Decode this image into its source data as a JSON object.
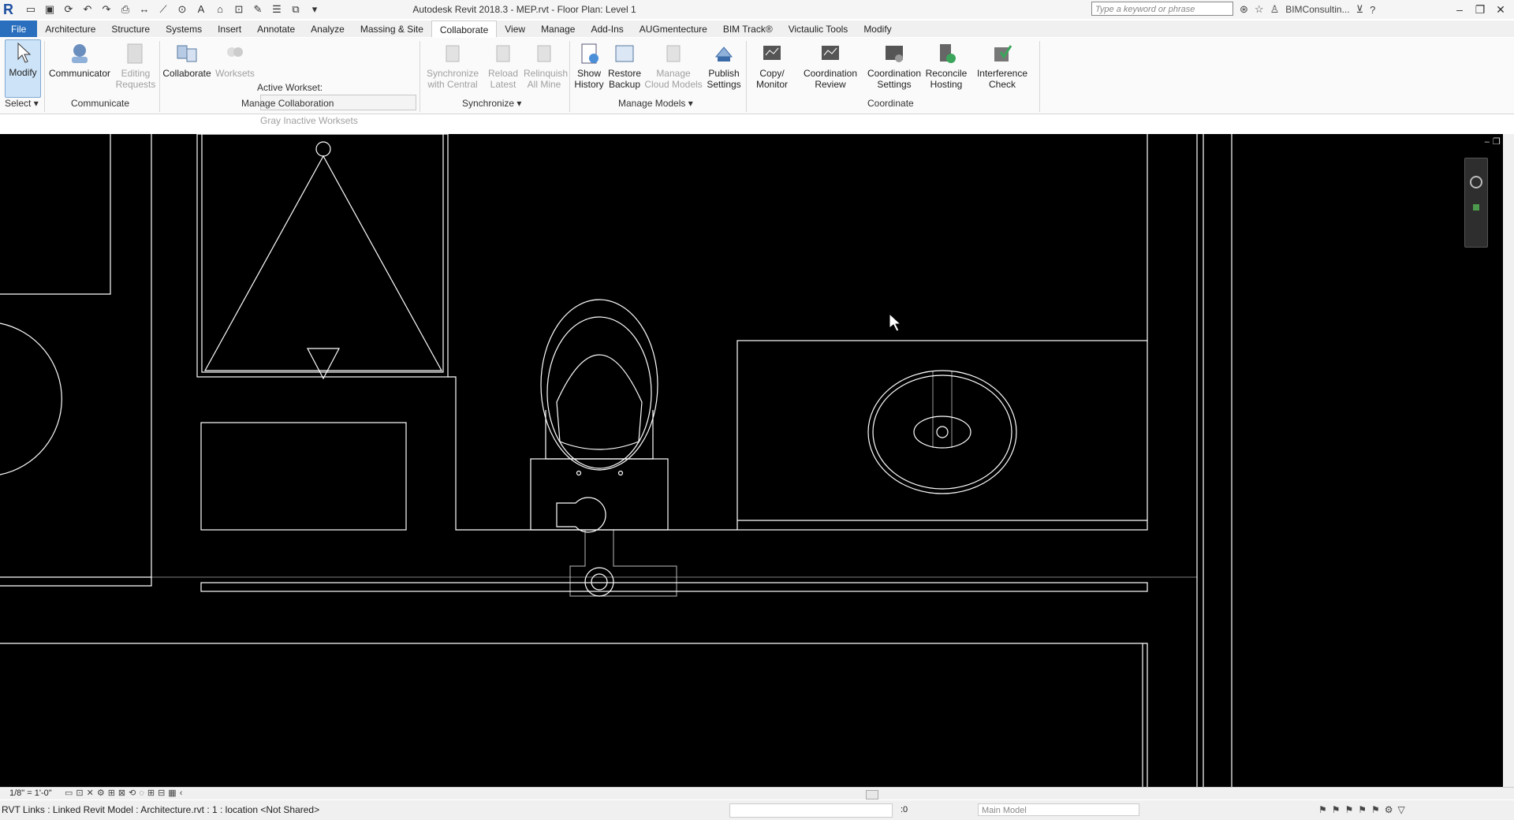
{
  "app": {
    "title": "Autodesk Revit 2018.3 -     MEP.rvt - Floor Plan: Level 1",
    "logo": "R",
    "search_placeholder": "Type a keyword or phrase",
    "user": "BIMConsultin..."
  },
  "quick_access": [
    "open-icon",
    "save-icon",
    "sync-icon",
    "undo-icon",
    "redo-icon",
    "print-icon",
    "measure-icon",
    "dimension-icon",
    "tag-icon",
    "text-icon",
    "3d-view-icon",
    "section-icon",
    "detail-line-icon",
    "thin-lines-icon",
    "close-windows-icon",
    "switch-windows-icon"
  ],
  "tabs": [
    "File",
    "Architecture",
    "Structure",
    "Systems",
    "Insert",
    "Annotate",
    "Analyze",
    "Massing & Site",
    "Collaborate",
    "View",
    "Manage",
    "Add-Ins",
    "AUGmentecture",
    "BIM Track®",
    "Victaulic Tools",
    "Modify"
  ],
  "ribbon": {
    "modify": "Modify",
    "select": "Select",
    "communicator": "Communicator",
    "editing_requests": "Editing Requests",
    "communicate": "Communicate",
    "collaborate": "Collaborate",
    "worksets": "Worksets",
    "active_workset": "Active Workset:",
    "gray_inactive": "Gray Inactive Worksets",
    "manage_collaboration": "Manage Collaboration",
    "sync_central": "Synchronize with Central",
    "reload_latest": "Reload Latest",
    "relinquish_all": "Relinquish All Mine",
    "synchronize": "Synchronize",
    "show_history": "Show History",
    "restore_backup": "Restore Backup",
    "manage_cloud": "Manage Cloud Models",
    "publish_settings": "Publish Settings",
    "manage_models": "Manage Models",
    "copy_monitor": "Copy/ Monitor",
    "coordination_review": "Coordination Review",
    "coordination_settings": "Coordination Settings",
    "reconcile_hosting": "Reconcile Hosting",
    "interference_check": "Interference Check",
    "coordinate": "Coordinate"
  },
  "viewbar": {
    "scale": "1/8\" = 1'-0\""
  },
  "status": {
    "message": "RVT Links : Linked Revit Model : Architecture.rvt : 1 : location <Not Shared>",
    "selection_count": ":0",
    "filter_count": ":0",
    "model": "Main Model"
  },
  "colors": {
    "file_tab": "#2a6fbe",
    "canvas": "#000000",
    "lines": "#ffffff"
  }
}
